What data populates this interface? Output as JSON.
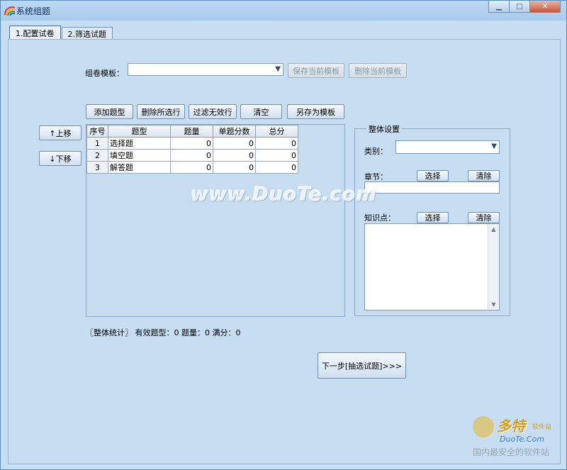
{
  "window": {
    "title": "系统组题"
  },
  "tabs": [
    {
      "label": "1.配置试卷",
      "active": true
    },
    {
      "label": "2.筛选试题",
      "active": false
    }
  ],
  "template": {
    "label": "组卷模板：",
    "value": "",
    "save_button": "保存当前模板",
    "delete_button": "删除当前模板"
  },
  "toolbar": {
    "add_type": "添加题型",
    "delete_selected": "删除所选行",
    "filter_invalid": "过滤无效行",
    "clear": "清空",
    "save_as_template": "另存为模板"
  },
  "move": {
    "up": "↑上移",
    "down": "↓下移"
  },
  "grid": {
    "columns": [
      "序号",
      "题型",
      "题量",
      "单题分数",
      "总分"
    ],
    "rows": [
      [
        "1",
        "选择题",
        "0",
        "0",
        "0"
      ],
      [
        "2",
        "填空题",
        "0",
        "0",
        "0"
      ],
      [
        "3",
        "解答题",
        "0",
        "0",
        "0"
      ]
    ]
  },
  "overall": {
    "title": "整体设置",
    "category_label": "类别：",
    "category_value": "",
    "chapter_label": "章节：",
    "chapter_select": "选择",
    "chapter_clear": "清除",
    "chapter_value": "",
    "knowledge_label": "知识点：",
    "knowledge_select": "选择",
    "knowledge_clear": "清除",
    "knowledge_value": ""
  },
  "stats": {
    "text": "〖整体统计〗 有效题型：0    题量：0    满分：0"
  },
  "next_button": "下一步[抽选试题]>>>",
  "watermark": {
    "center": "www.DuoTe.com",
    "brand": "多特",
    "brand_sub": "软件站",
    "url": "DuoTe.Com",
    "slogan": "国内最安全的软件站"
  },
  "colors": {
    "window_bg": "#c7ddf2",
    "titlebar": "#a9cbec",
    "close_button": "#c9553a"
  }
}
